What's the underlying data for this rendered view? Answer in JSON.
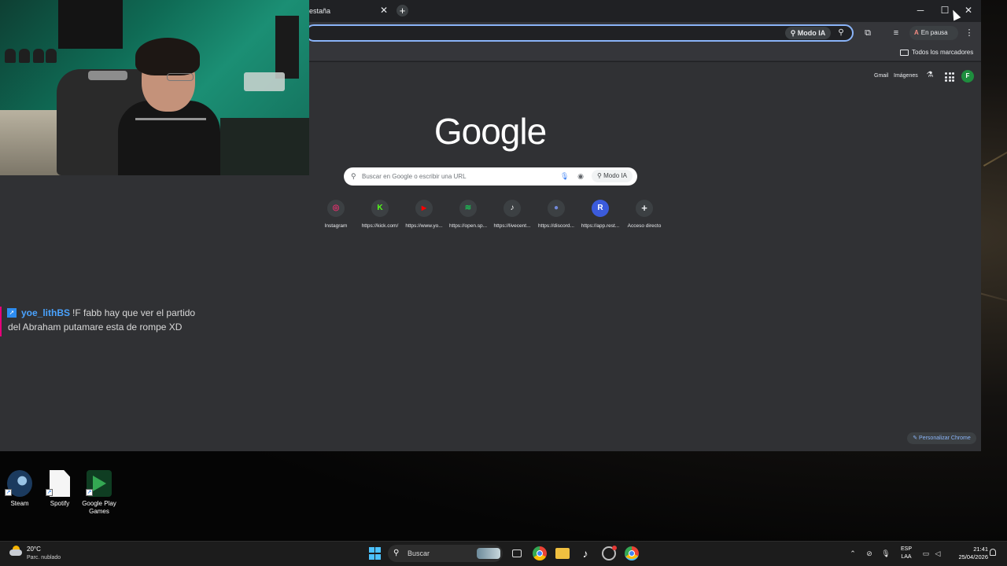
{
  "browser": {
    "tab_title": "estaña",
    "tab_close": "✕",
    "new_tab": "+",
    "window_controls": {
      "minimize": "─",
      "maximize": "☐",
      "close": "✕"
    },
    "omnibox": {
      "modo_ia": "Modo IA",
      "search_icon": "search-icon"
    },
    "profile_pill": {
      "avatar_letter": "A",
      "label": "En pausa"
    },
    "menu": "⋮",
    "bookmarks": {
      "all_label": "Todos los marcadores"
    }
  },
  "ntp": {
    "top_links": {
      "gmail": "Gmail",
      "images": "Imágenes"
    },
    "avatar_letter": "F",
    "logo": "Google",
    "search": {
      "placeholder": "Buscar en Google o escribir una URL",
      "modo_ia": "Modo IA"
    },
    "shortcuts": [
      {
        "label": "Instagram",
        "glyph": "◎",
        "color": "#e1306c"
      },
      {
        "label": "https://kick.com/",
        "glyph": "K",
        "color": "#53fc18"
      },
      {
        "label": "https://www.yo...",
        "glyph": "▶",
        "color": "#ff0000"
      },
      {
        "label": "https://open.sp...",
        "glyph": "≋",
        "color": "#1db954"
      },
      {
        "label": "https://livecent...",
        "glyph": "♪",
        "color": "#ffffff"
      },
      {
        "label": "https://discord...",
        "glyph": "●",
        "color": "#7289da"
      },
      {
        "label": "https://app.rest...",
        "glyph": "R",
        "color": "#3b5bdb"
      },
      {
        "label": "Acceso directo",
        "glyph": "+",
        "color": "#e8eaed"
      }
    ],
    "customize": "Personalizar Chrome"
  },
  "chat": {
    "user": "yoe_lithBS",
    "line1": "!F fabb hay que ver el partido",
    "line2": "del Abraham putamare esta de rompe XD"
  },
  "desktop_icons": [
    {
      "label": "Steam"
    },
    {
      "label": "Spotify"
    },
    {
      "label": "Google Play Games"
    }
  ],
  "taskbar": {
    "weather_temp": "20°C",
    "weather_desc": "Parc. nublado",
    "search_label": "Buscar",
    "lang_top": "ESP",
    "lang_bottom": "LAA",
    "time": "21:41",
    "date": "25/04/2026"
  },
  "colors": {
    "accent": "#8ab4f8",
    "chrome_bg": "#303134",
    "twitch_border": "#e6007a",
    "chat_user": "#4aa3ff"
  }
}
